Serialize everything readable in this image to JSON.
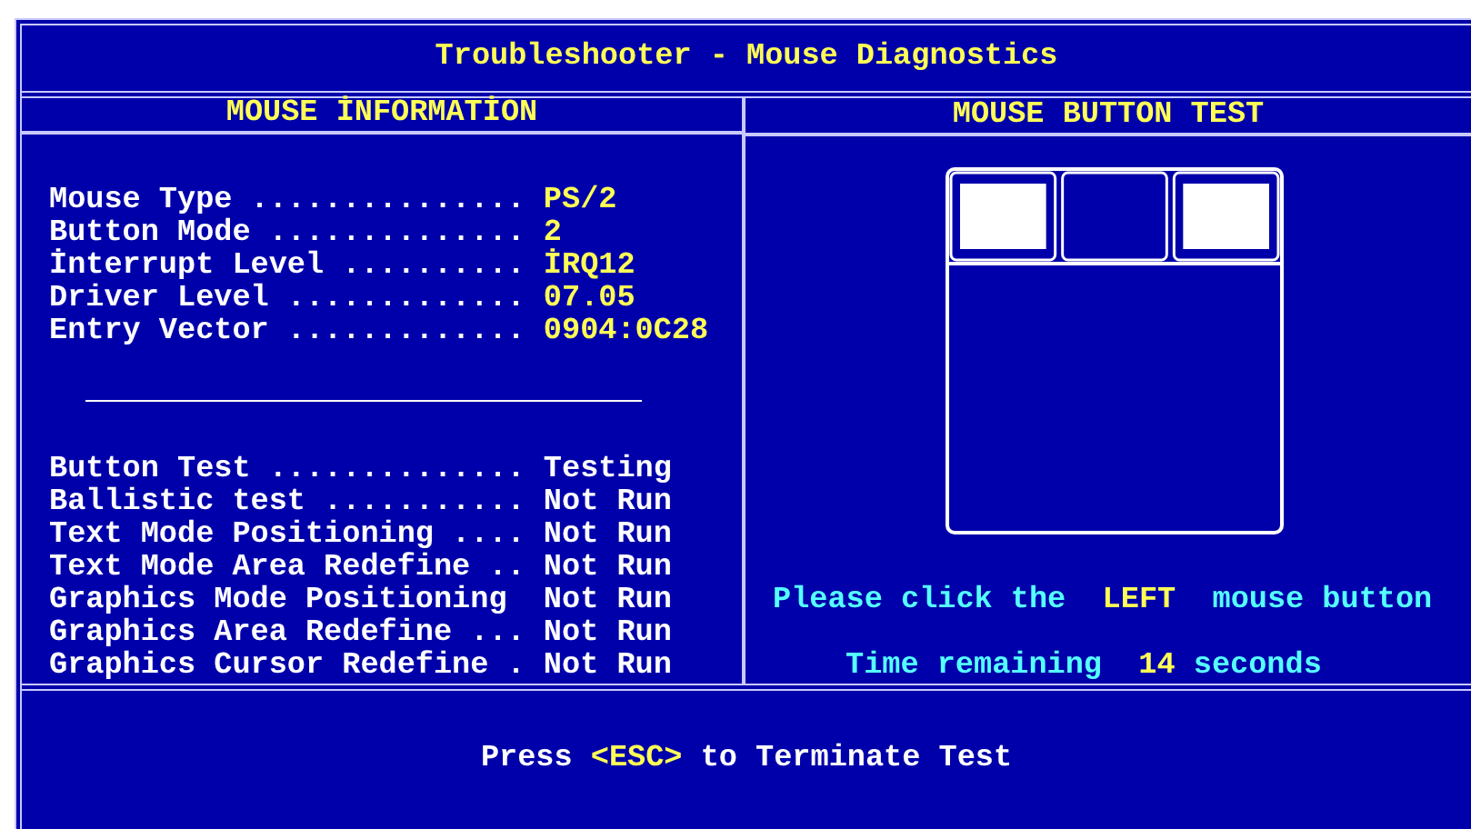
{
  "window": {
    "title": "Troubleshooter - Mouse Diagnostics"
  },
  "left_panel": {
    "title": "MOUSE İNFORMATİON",
    "info_rows": [
      {
        "label": "Mouse Type ...............",
        "value": "PS/2"
      },
      {
        "label": "Button Mode ..............",
        "value": "2"
      },
      {
        "label": "İnterrupt Level ..........",
        "value": "İRQ12"
      },
      {
        "label": "Driver Level .............",
        "value": "07.05"
      },
      {
        "label": "Entry Vector .............",
        "value": "0904:0C28"
      }
    ],
    "test_rows": [
      {
        "label": "Button Test ..............",
        "value": "Testing"
      },
      {
        "label": "Ballistic test ...........",
        "value": "Not Run"
      },
      {
        "label": "Text Mode Positioning ....",
        "value": "Not Run"
      },
      {
        "label": "Text Mode Area Redefine ..",
        "value": "Not Run"
      },
      {
        "label": "Graphics Mode Positioning ",
        "value": "Not Run"
      },
      {
        "label": "Graphics Area Redefine ...",
        "value": "Not Run"
      },
      {
        "label": "Graphics Cursor Redefine .",
        "value": "Not Run"
      }
    ]
  },
  "right_panel": {
    "title": "MOUSE BUTTON TEST",
    "mouse_buttons": [
      {
        "lit": true
      },
      {
        "lit": false
      },
      {
        "lit": true
      }
    ],
    "instruction": {
      "before": "Please click the",
      "highlight": "LEFT",
      "after": "mouse button"
    },
    "timer": {
      "before": "Time remaining",
      "highlight": "14",
      "after": "seconds"
    }
  },
  "footer": {
    "before": "Press",
    "key": "<ESC>",
    "after": "to Terminate Test"
  }
}
